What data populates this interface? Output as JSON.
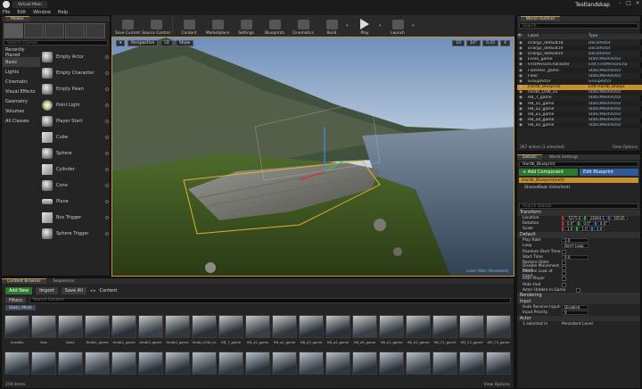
{
  "app": {
    "tab_title": "Virtual Main",
    "project": "Testlandskap"
  },
  "menu": [
    "File",
    "Edit",
    "Window",
    "Help"
  ],
  "modes": {
    "tab": "Modes",
    "search_placeholder": "Search Classes",
    "categories": [
      "Recently Placed",
      "Basic",
      "Lights",
      "Cinematic",
      "Visual Effects",
      "Geometry",
      "Volumes",
      "All Classes"
    ],
    "selected_category": "Basic",
    "items": [
      "Empty Actor",
      "Empty Character",
      "Empty Pawn",
      "Point Light",
      "Player Start",
      "Cube",
      "Sphere",
      "Cylinder",
      "Cone",
      "Plane",
      "Box Trigger",
      "Sphere Trigger"
    ]
  },
  "toolbar": [
    "Save Current",
    "Source Control",
    "Content",
    "Marketplace",
    "Settings",
    "Blueprints",
    "Cinematics",
    "Build",
    "Play",
    "Launch"
  ],
  "viewport": {
    "perspective": "Perspective",
    "lit": "Lit",
    "show": "Show",
    "snap_values": [
      "10",
      "10°",
      "0.25"
    ],
    "camera_speed": "4",
    "watermark": "Level: Main (Persistent)"
  },
  "content_browser": {
    "tabs": [
      "Content Browser",
      "Sequencer"
    ],
    "add_new": "Add New",
    "import": "Import",
    "save_all": "Save All",
    "path": "Content",
    "filters": "Filters",
    "search_placeholder": "Search Content",
    "filter_chip": "Static Mesh",
    "row1": [
      "GreeBlo",
      "Bub",
      "Bub2",
      "Hedb1_game",
      "Hedb2_game",
      "Hedb3_game",
      "Hedb4_game",
      "Hedb_LOW_co",
      "HB_7_game",
      "HB_a1_game",
      "HB_a2_game",
      "HB_a3_game",
      "HB_a4_game",
      "HB_a5_game",
      "HB_b1_game",
      "HB_b2_game",
      "HB_C1_game",
      "HB_C2_game",
      "HB_C3_game"
    ],
    "row2_count": 19,
    "status": "259 items",
    "view_options": "View Options"
  },
  "outliner": {
    "tab": "World Outliner",
    "search_placeholder": "Search...",
    "columns": [
      "Label",
      "Type"
    ],
    "rows": [
      {
        "label": "DTarg2_default18",
        "type": "DecalActor"
      },
      {
        "label": "DTarg2_default19",
        "type": "DecalActor"
      },
      {
        "label": "DTarg2_default20",
        "type": "DecalActor"
      },
      {
        "label": "Elven_game",
        "type": "StaticMeshActor"
      },
      {
        "label": "FirstPersonCharacter",
        "type": "Edit FirstPersonCha"
      },
      {
        "label": "Flatsteer_game",
        "type": "StaticMeshActor"
      },
      {
        "label": "Floor",
        "type": "StaticMeshActor"
      },
      {
        "label": "GroupActor",
        "type": "GroupActor"
      },
      {
        "label": "Hardb_Blueprint",
        "type": "Edit Hardb_Bluepr"
      },
      {
        "label": "hardb_LOW_co",
        "type": "StaticMeshActor"
      },
      {
        "label": "HB_7_game",
        "type": "StaticMeshActor"
      },
      {
        "label": "HB_a1_game",
        "type": "StaticMeshActor"
      },
      {
        "label": "HB_a2_game",
        "type": "StaticMeshActor"
      },
      {
        "label": "HB_a3_game",
        "type": "StaticMeshActor"
      },
      {
        "label": "HB_a4_game",
        "type": "StaticMeshActor"
      },
      {
        "label": "HB_a5_game",
        "type": "StaticMeshActor"
      }
    ],
    "selected_index": 8,
    "status": "267 actors (1 selected)",
    "view_options": "View Options"
  },
  "details": {
    "tabs": [
      "Details",
      "World Settings"
    ],
    "object_name": "Hardb_Blueprint",
    "add_component": "+ Add Component",
    "edit_blueprint": "Edit Blueprint",
    "self_item": "Hardb_Blueprint(self)",
    "root_item": "SharedRoot (Inherited)",
    "search_placeholder": "Search Details",
    "transform": "Transform",
    "location": {
      "label": "Location",
      "x": "-5275.0",
      "y": "23044.1",
      "z": "10535"
    },
    "rotation": {
      "label": "Rotation",
      "x": "0.0°",
      "y": "0.0°",
      "z": "0.0°"
    },
    "scale": {
      "label": "Scale",
      "x": "1.0",
      "y": "1.0",
      "z": "1.0"
    },
    "default_section": "Default",
    "props": [
      {
        "k": "Play Rate",
        "v": "1.0"
      },
      {
        "k": "Loop",
        "v": "Don't Loop"
      },
      {
        "k": "Random Start Time",
        "v": ""
      },
      {
        "k": "Start Time",
        "v": "0.0"
      },
      {
        "k": "Restore State",
        "v": ""
      },
      {
        "k": "Disable Movement Input",
        "v": ""
      },
      {
        "k": "Disable Look at Input",
        "v": ""
      },
      {
        "k": "Hide Player",
        "v": ""
      },
      {
        "k": "Hide Hud",
        "v": ""
      }
    ],
    "actor_section": "Actor Hidden In Game",
    "rendering": "Rendering",
    "input": "Input",
    "auto_receive": {
      "k": "Auto Receive Input",
      "v": "Disabled"
    },
    "input_priority": {
      "k": "Input Priority",
      "v": "0"
    },
    "actor": "Actor",
    "selected_info": "1 selected in",
    "persistent": "Persistent Level"
  },
  "colors": {
    "accent": "#c8902c",
    "add_green": "#2a7a2a",
    "edit_blue": "#2c5a9a"
  }
}
